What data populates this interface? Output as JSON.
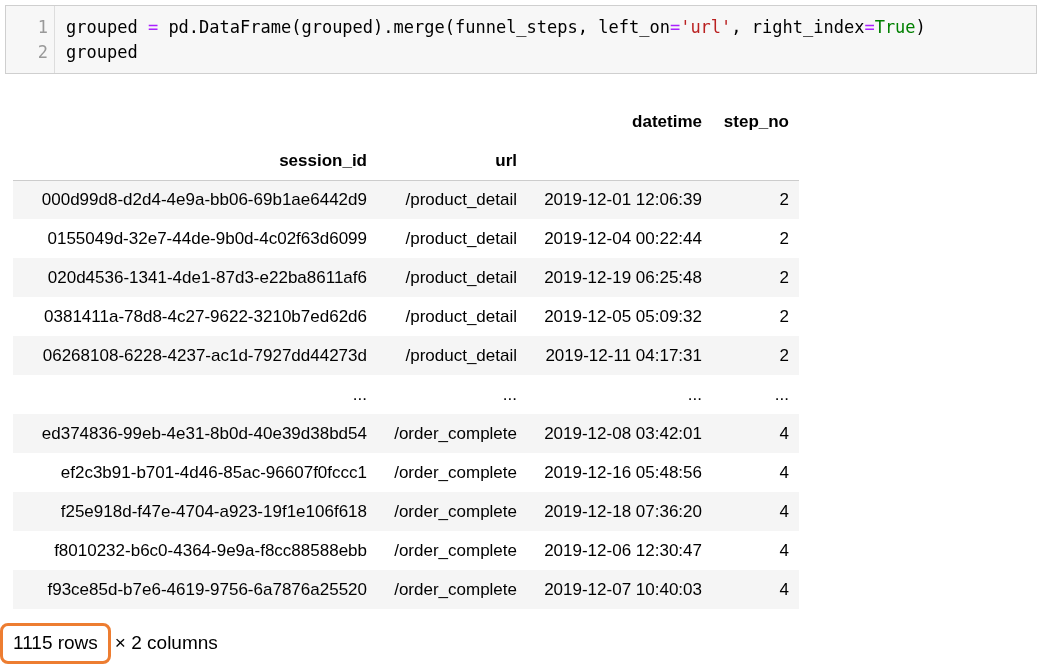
{
  "code_cell": {
    "lines": [
      {
        "number": "1",
        "tokens": [
          {
            "kind": "plain",
            "text": "grouped "
          },
          {
            "kind": "operator",
            "text": "="
          },
          {
            "kind": "plain",
            "text": " pd.DataFrame(grouped).merge(funnel_steps, left_on"
          },
          {
            "kind": "operator",
            "text": "="
          },
          {
            "kind": "string",
            "text": "'url'"
          },
          {
            "kind": "plain",
            "text": ", right_index"
          },
          {
            "kind": "operator",
            "text": "="
          },
          {
            "kind": "keyword",
            "text": "True"
          },
          {
            "kind": "plain",
            "text": ")"
          }
        ]
      },
      {
        "number": "2",
        "tokens": [
          {
            "kind": "plain",
            "text": "grouped"
          }
        ]
      }
    ]
  },
  "table": {
    "column_headers": [
      "datetime",
      "step_no"
    ],
    "index_headers": [
      "session_id",
      "url"
    ],
    "rows": [
      {
        "session_id": "000d99d8-d2d4-4e9a-bb06-69b1ae6442d9",
        "url": "/product_detail",
        "datetime": "2019-12-01 12:06:39",
        "step_no": "2"
      },
      {
        "session_id": "0155049d-32e7-44de-9b0d-4c02f63d6099",
        "url": "/product_detail",
        "datetime": "2019-12-04 00:22:44",
        "step_no": "2"
      },
      {
        "session_id": "020d4536-1341-4de1-87d3-e22ba8611af6",
        "url": "/product_detail",
        "datetime": "2019-12-19 06:25:48",
        "step_no": "2"
      },
      {
        "session_id": "0381411a-78d8-4c27-9622-3210b7ed62d6",
        "url": "/product_detail",
        "datetime": "2019-12-05 05:09:32",
        "step_no": "2"
      },
      {
        "session_id": "06268108-6228-4237-ac1d-7927dd44273d",
        "url": "/product_detail",
        "datetime": "2019-12-11 04:17:31",
        "step_no": "2"
      },
      {
        "session_id": "...",
        "url": "...",
        "datetime": "...",
        "step_no": "..."
      },
      {
        "session_id": "ed374836-99eb-4e31-8b0d-40e39d38bd54",
        "url": "/order_complete",
        "datetime": "2019-12-08 03:42:01",
        "step_no": "4"
      },
      {
        "session_id": "ef2c3b91-b701-4d46-85ac-96607f0fccc1",
        "url": "/order_complete",
        "datetime": "2019-12-16 05:48:56",
        "step_no": "4"
      },
      {
        "session_id": "f25e918d-f47e-4704-a923-19f1e106f618",
        "url": "/order_complete",
        "datetime": "2019-12-18 07:36:20",
        "step_no": "4"
      },
      {
        "session_id": "f8010232-b6c0-4364-9e9a-f8cc88588ebb",
        "url": "/order_complete",
        "datetime": "2019-12-06 12:30:47",
        "step_no": "4"
      },
      {
        "session_id": "f93ce85d-b7e6-4619-9756-6a7876a25520",
        "url": "/order_complete",
        "datetime": "2019-12-07 10:40:03",
        "step_no": "4"
      }
    ]
  },
  "shape_summary": [
    {
      "text": "1115 rows",
      "highlighted": true
    },
    {
      "text": "× 2 columns",
      "highlighted": false
    }
  ]
}
